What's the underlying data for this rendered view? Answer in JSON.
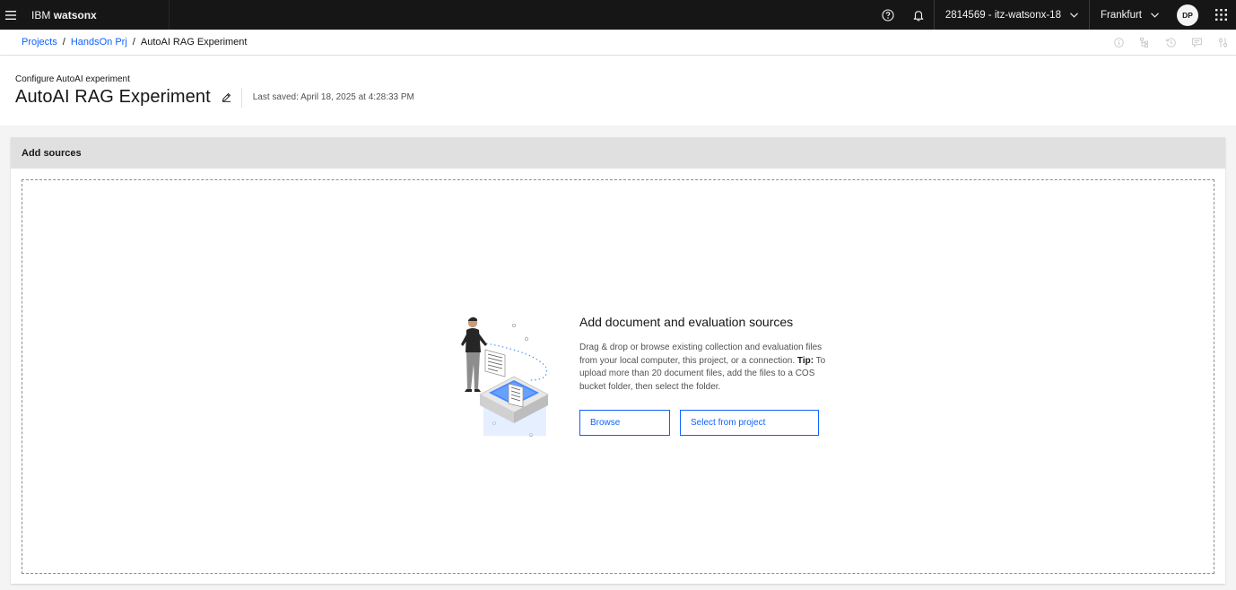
{
  "topbar": {
    "product_prefix": "IBM",
    "product_name": "watsonx",
    "account": "2814569 - itz-watsonx-18",
    "region": "Frankfurt",
    "avatar_initials": "DP",
    "icons": [
      "menu-icon",
      "help-icon",
      "notification-icon",
      "chevron-down-icon",
      "app-switcher-icon"
    ]
  },
  "breadcrumb": {
    "items": [
      "Projects",
      "HandsOn Prj",
      "AutoAI RAG Experiment"
    ],
    "separator": "/",
    "tools": [
      "info-icon",
      "hierarchy-icon",
      "history-icon",
      "chat-icon",
      "settings-icon"
    ]
  },
  "header": {
    "subtitle": "Configure AutoAI experiment",
    "title": "AutoAI RAG Experiment",
    "last_saved": "Last saved: April 18, 2025 at 4:28:33 PM"
  },
  "panel": {
    "title": "Add sources",
    "drop_title": "Add document and evaluation sources",
    "drop_desc": "Drag & drop or browse existing collection and evaluation files from your local computer, this project, or a connection.",
    "tip_label": "Tip:",
    "tip_text": "To upload more than 20 document files, add the files to a COS bucket folder, then select the folder.",
    "browse_label": "Browse",
    "select_project_label": "Select from project"
  },
  "colors": {
    "topbar_bg": "#161616",
    "link": "#0f62fe",
    "panel_header_bg": "#e0e0e0",
    "content_bg": "#f4f4f4"
  }
}
